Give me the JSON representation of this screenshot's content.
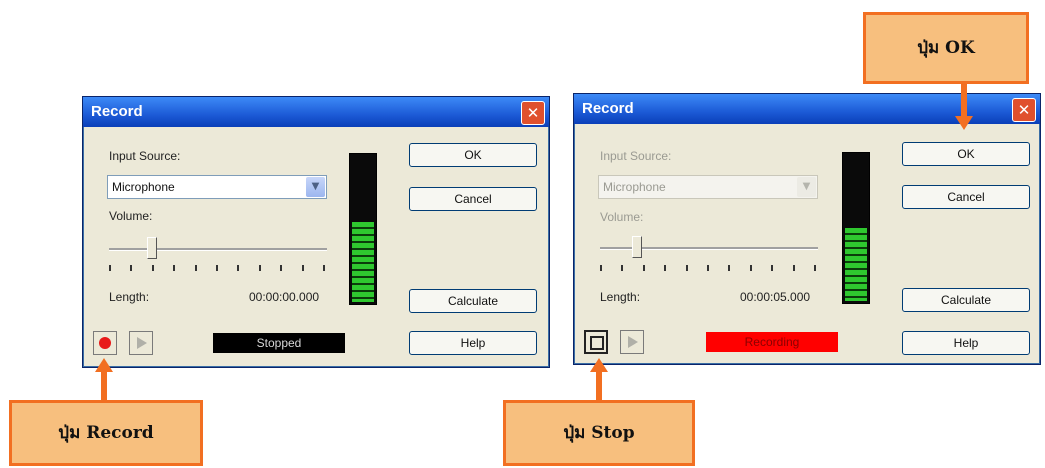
{
  "dialogs": [
    {
      "title": "Record",
      "input_source_label": "Input Source:",
      "input_source_value": "Microphone",
      "volume_label": "Volume:",
      "length_label": "Length:",
      "length_value": "00:00:00.000",
      "buttons": {
        "ok": "OK",
        "cancel": "Cancel",
        "calculate": "Calculate",
        "help": "Help"
      },
      "status_text": "Stopped",
      "status_color": "#000000",
      "volume_level": 0.18,
      "meter_level": 0.55
    },
    {
      "title": "Record",
      "input_source_label": "Input Source:",
      "input_source_value": "Microphone",
      "volume_label": "Volume:",
      "length_label": "Length:",
      "length_value": "00:00:05.000",
      "buttons": {
        "ok": "OK",
        "cancel": "Cancel",
        "calculate": "Calculate",
        "help": "Help"
      },
      "status_text": "Recording",
      "status_color": "#ff0000",
      "volume_level": 0.15,
      "meter_level": 0.5
    }
  ],
  "callouts": {
    "record": "ปุ่ม Record",
    "stop": "ปุ่ม Stop",
    "ok": "ปุ่ม OK"
  },
  "colors": {
    "callout_fill": "#f7bf7e",
    "callout_border": "#f26f21"
  },
  "icons": {
    "record": "record-circle-icon",
    "play": "play-icon",
    "stop": "stop-icon",
    "close": "close-x-icon",
    "dropdown": "chevron-down-icon"
  }
}
